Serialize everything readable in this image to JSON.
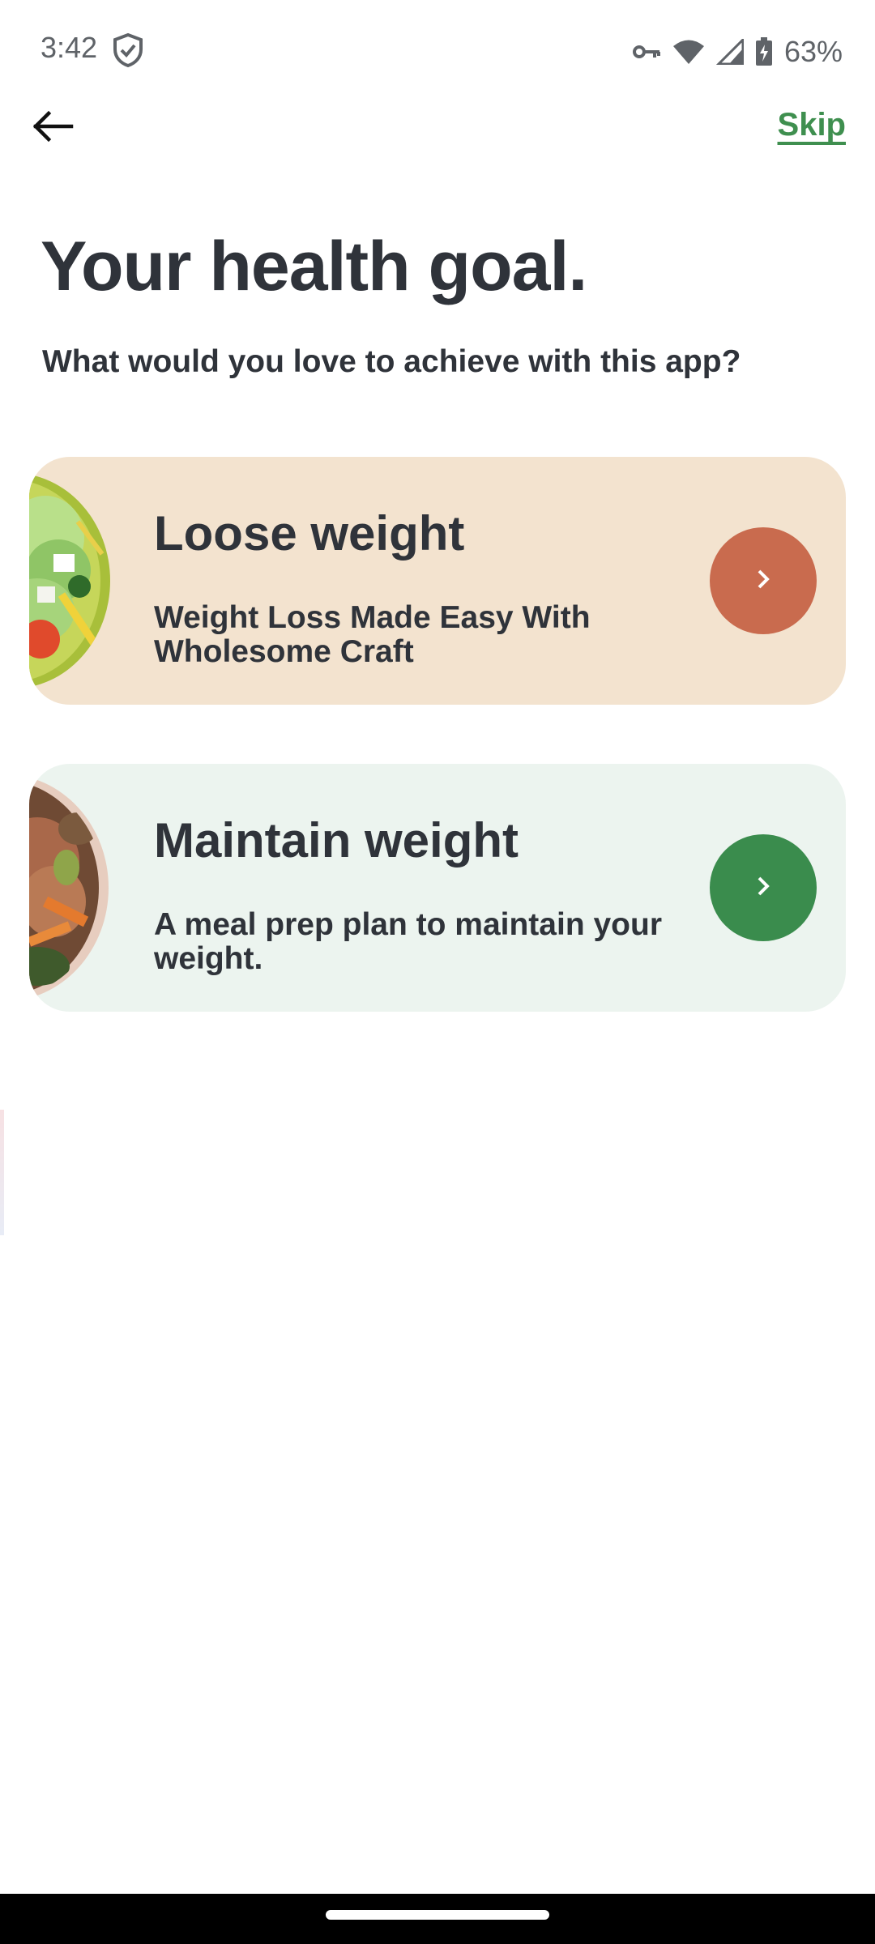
{
  "status_bar": {
    "time": "3:42",
    "battery": "63%",
    "icons": [
      "shield-icon",
      "key-icon",
      "wifi-icon",
      "cellular-signal-icon",
      "battery-charging-icon"
    ]
  },
  "nav": {
    "back_icon": "arrow-left-icon",
    "skip_label": "Skip"
  },
  "header": {
    "title": "Your health goal.",
    "subtitle": "What would you love to achieve with this app?"
  },
  "goals": [
    {
      "title": "Loose weight",
      "description": "Weight Loss Made Easy With Wholesome Craft",
      "accent": "#c96b4e",
      "background": "#f3e3cf",
      "icon": "chevron-right-icon"
    },
    {
      "title": "Maintain weight",
      "description": "A meal prep plan to maintain your weight.",
      "accent": "#3a8c4d",
      "background": "#ecf4ef",
      "icon": "chevron-right-icon"
    }
  ],
  "colors": {
    "brand_green": "#3f8f4f",
    "text_dark": "#2f333a"
  }
}
